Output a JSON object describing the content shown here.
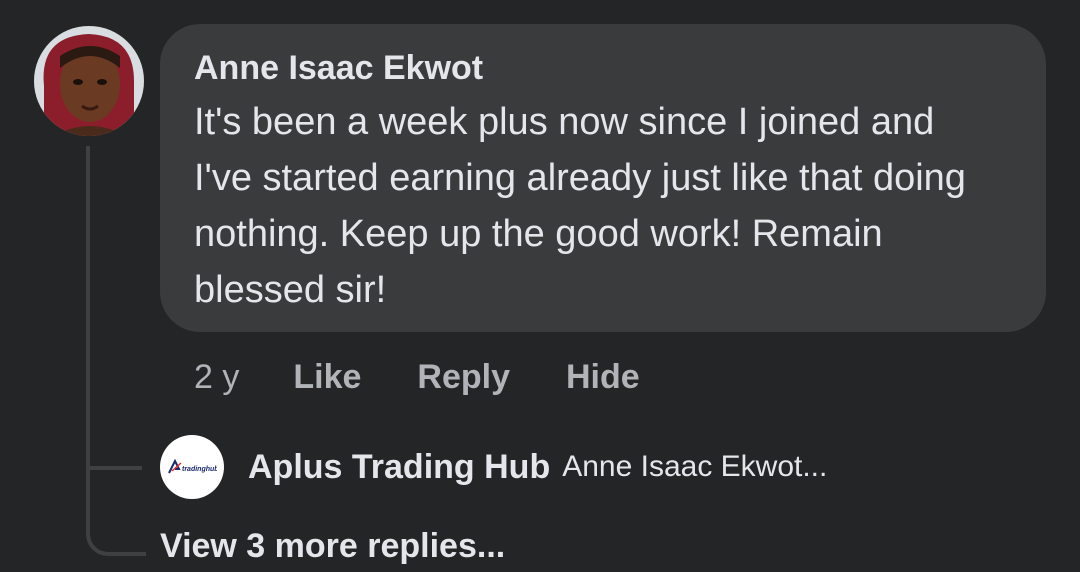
{
  "comment": {
    "author": "Anne Isaac Ekwot",
    "text": "It's been a week plus now since I joined and I've started earning already just like that doing nothing. Keep up the good work! Remain blessed sir!",
    "time": "2 y",
    "actions": {
      "like": "Like",
      "reply": "Reply",
      "hide": "Hide"
    }
  },
  "reply": {
    "author": "Aplus Trading Hub",
    "preview": "Anne Isaac Ekwot...",
    "avatar_logo_text": "tradinghub"
  },
  "view_more": "View 3 more replies...",
  "colors": {
    "background": "#242526",
    "bubble": "#3a3b3c",
    "primary_text": "#e4e6eb",
    "secondary_text": "#b0b3b8"
  }
}
